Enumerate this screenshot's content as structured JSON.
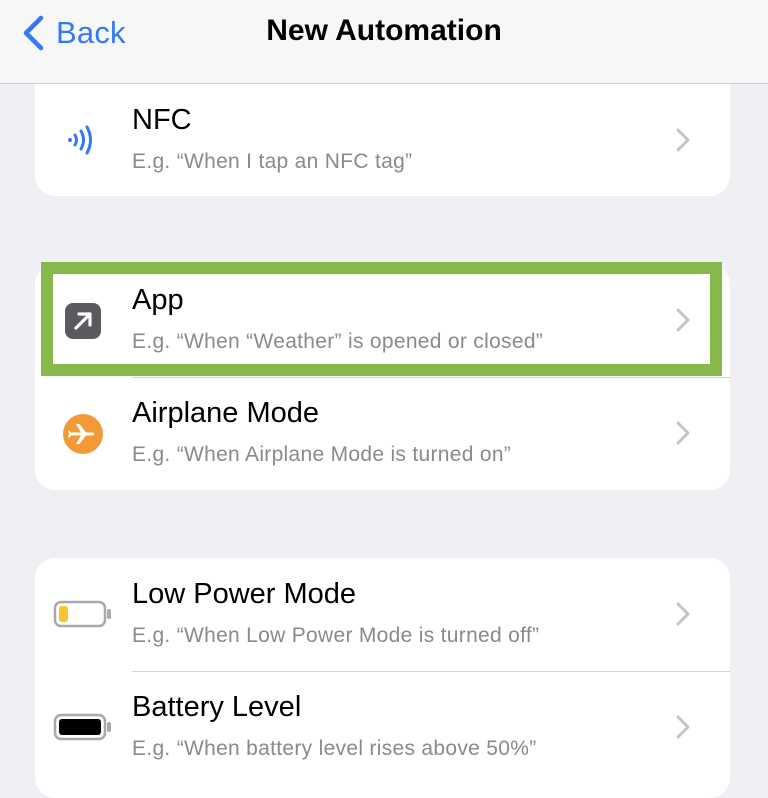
{
  "navbar": {
    "back_label": "Back",
    "title": "New Automation",
    "accent_color": "#3478f6"
  },
  "groups": [
    {
      "items": [
        {
          "title": "NFC",
          "subtitle": "E.g. “When I tap an NFC tag”",
          "icon": "nfc-icon"
        }
      ]
    },
    {
      "items": [
        {
          "title": "App",
          "subtitle": "E.g. “When “Weather” is opened or closed”",
          "icon": "app-arrow-icon",
          "highlighted": true
        },
        {
          "title": "Airplane Mode",
          "subtitle": "E.g. “When Airplane Mode is turned on”",
          "icon": "airplane-icon"
        }
      ]
    },
    {
      "items": [
        {
          "title": "Low Power Mode",
          "subtitle": "E.g. “When Low Power Mode is turned off”",
          "icon": "low-battery-icon"
        },
        {
          "title": "Battery Level",
          "subtitle": "E.g. “When battery level rises above 50%”",
          "icon": "battery-icon"
        }
      ]
    }
  ],
  "colors": {
    "highlight_border": "#86b94a",
    "airplane_orange": "#f29a38",
    "low_power_yellow": "#f7c62f",
    "nfc_blue": "#3478f6"
  }
}
